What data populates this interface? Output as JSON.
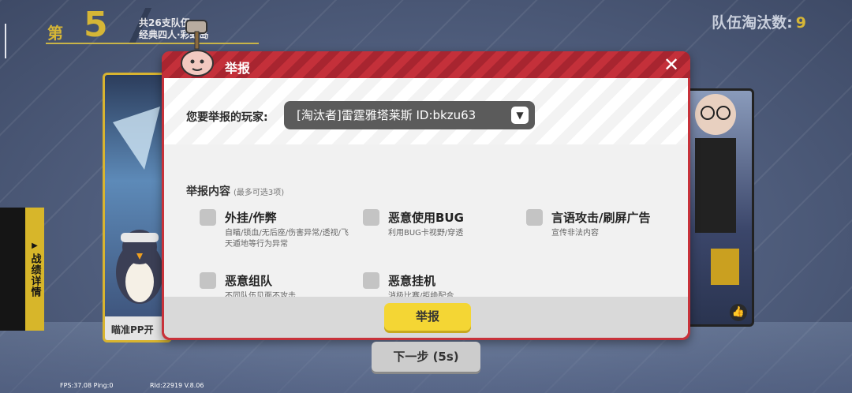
{
  "round": {
    "prefix": "第",
    "number": "5",
    "info_line1": "共26支队伍",
    "info_line2": "经典四人·彩虹岛"
  },
  "eliminated": {
    "label": "队伍淘汰数:",
    "value": "9"
  },
  "stats_tab": {
    "arrow": "▶",
    "label": "战绩详情"
  },
  "cards": {
    "left_caption": "瞄准PP开",
    "like_icon": "👍"
  },
  "dialog": {
    "title": "举报",
    "close": "✕",
    "player_label": "您要举报的玩家:",
    "player_value": "[淘汰者]雷霆雅塔莱斯 ID:bkzu63",
    "section_title": "举报内容",
    "section_hint": "(最多可选3项)",
    "options": [
      {
        "label": "外挂/作弊",
        "desc": "自瞄/锁血/无后座/伤害异常/透视/飞天遁地等行为异常"
      },
      {
        "label": "恶意使用BUG",
        "desc": "利用BUG卡视野/穿透"
      },
      {
        "label": "言语攻击/刷屏广告",
        "desc": "宣传非法内容"
      },
      {
        "label": "恶意组队",
        "desc": "不同队伍见面不攻击"
      },
      {
        "label": "恶意挂机",
        "desc": "消极比赛/拒绝配合"
      }
    ],
    "report_button": "举报"
  },
  "next_button": "下一步 (5s)",
  "footer": {
    "fps": "FPS:37.08 Ping:0",
    "rid": "RId:22919 V.8.06"
  },
  "colors": {
    "accent_gold": "#d6b636",
    "dialog_red": "#c8323a",
    "button_yellow": "#f4d634"
  }
}
